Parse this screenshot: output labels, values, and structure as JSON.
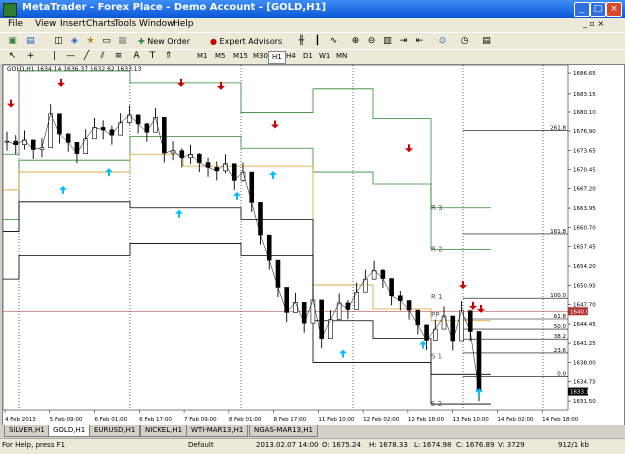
{
  "window": {
    "title": "MetaTrader - Forex Place - Demo Account - [GOLD,H1]",
    "controls": [
      "_",
      "□",
      "×"
    ]
  },
  "menu": [
    "File",
    "View",
    "Insert",
    "Charts",
    "Tools",
    "Window",
    "Help"
  ],
  "toolbar": {
    "new_order": "New Order",
    "expert_advisors": "Expert Advisors"
  },
  "timeframes": [
    "M1",
    "M5",
    "M15",
    "M30",
    "H1",
    "H4",
    "D1",
    "W1",
    "MN"
  ],
  "active_timeframe": "H1",
  "chart": {
    "symbol_info": "GOLD,H1  1634.14 1636.37 1632.62 1633.13",
    "current_price": "1640.00",
    "last_price": "1633.13",
    "pivot_labels": [
      "R 3",
      "R 2",
      "R 1",
      "PP",
      "S 1",
      "S 2"
    ],
    "fib_labels": [
      "261.8",
      "161.8",
      "100.0",
      "61.8",
      "50.0",
      "38.2",
      "23.6",
      "0.0"
    ],
    "colors": {
      "candle": "#000000",
      "up_arrow": "#00bfff",
      "down_arrow": "#cc0000",
      "pivot_r": "#2e8b2e",
      "pivot_pp": "#e0a030",
      "pivot_s": "#000000",
      "price_line": "#b03030"
    }
  },
  "chart_data": {
    "type": "line",
    "title": "GOLD,H1",
    "x_ticks": [
      "4 Feb 2013",
      "5 Feb 09:00",
      "6 Feb 01:00",
      "6 Feb 17:00",
      "7 Feb 09:00",
      "8 Feb 01:00",
      "8 Feb 17:00",
      "11 Feb 10:00",
      "12 Feb 02:00",
      "12 Feb 18:00",
      "13 Feb 10:00",
      "14 Feb 02:00",
      "14 Feb 18:00"
    ],
    "y_ticks": [
      1686.65,
      1683.15,
      1680.1,
      1676.9,
      1673.65,
      1670.45,
      1667.2,
      1663.95,
      1660.7,
      1657.45,
      1654.2,
      1650.95,
      1647.7,
      1644.45,
      1641.25,
      1638.0,
      1634.75,
      1631.5
    ],
    "ylim": [
      1630.0,
      1688.0
    ],
    "price_series": {
      "name": "GOLD,H1",
      "y": [
        1675.2,
        1674.6,
        1675.4,
        1673.8,
        1674.1,
        1679.8,
        1676.4,
        1675.0,
        1673.1,
        1675.6,
        1677.5,
        1677.1,
        1676.2,
        1678.3,
        1679.6,
        1678.1,
        1676.7,
        1679.2,
        1673.2,
        1673.6,
        1672.4,
        1673.0,
        1671.6,
        1670.8,
        1670.2,
        1671.4,
        1668.6,
        1670.0,
        1664.9,
        1659.4,
        1655.2,
        1650.6,
        1646.4,
        1648.1,
        1644.6,
        1648.5,
        1642.0,
        1645.2,
        1648.0,
        1646.9,
        1649.8,
        1652.0,
        1653.5,
        1652.1,
        1649.2,
        1648.4,
        1646.8,
        1644.3,
        1641.7,
        1643.6,
        1645.8,
        1641.6,
        1646.7,
        1643.2,
        1633.1
      ]
    },
    "signal_arrows_up": [
      1667.0,
      1670.0,
      1663.0,
      1666.0,
      1669.5,
      1639.5,
      1641.0,
      1633.0
    ],
    "signal_arrows_down": [
      1681.5,
      1685.0,
      1685.0,
      1684.5,
      1678.0,
      1674.0,
      1651.0,
      1647.5,
      1647.0
    ]
  }
}
